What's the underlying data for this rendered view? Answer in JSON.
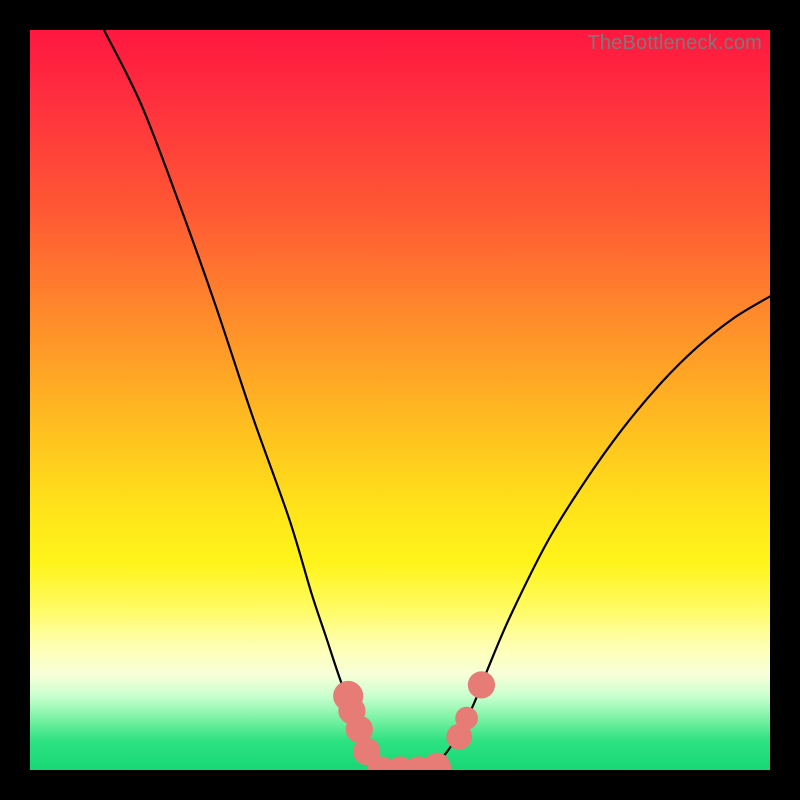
{
  "watermark": "TheBottleneck.com",
  "chart_data": {
    "type": "line",
    "title": "",
    "xlabel": "",
    "ylabel": "",
    "xlim": [
      0,
      100
    ],
    "ylim": [
      0,
      100
    ],
    "grid": false,
    "legend": false,
    "series": [
      {
        "name": "bottleneck-curve",
        "x": [
          10,
          15,
          20,
          25,
          30,
          35,
          38,
          40,
          42,
          44,
          45,
          46,
          48,
          50,
          52,
          54,
          56,
          58,
          60,
          62,
          65,
          70,
          75,
          80,
          85,
          90,
          95,
          100
        ],
        "y": [
          100,
          90,
          77,
          63,
          48,
          34,
          24,
          18,
          12,
          7,
          4,
          2,
          0,
          0,
          0,
          0,
          2,
          5,
          9,
          14,
          21,
          31,
          39,
          46,
          52,
          57,
          61,
          64
        ]
      }
    ],
    "markers": [
      {
        "name": "left-cluster-1",
        "x": 43.0,
        "y": 10.0,
        "r": 1.5
      },
      {
        "name": "left-cluster-2",
        "x": 43.5,
        "y": 8.0,
        "r": 1.3
      },
      {
        "name": "left-cluster-3",
        "x": 44.5,
        "y": 5.5,
        "r": 1.3
      },
      {
        "name": "left-cluster-4",
        "x": 45.5,
        "y": 2.5,
        "r": 1.3
      },
      {
        "name": "trough-1",
        "x": 47.5,
        "y": 0.0,
        "r": 1.3
      },
      {
        "name": "trough-2",
        "x": 50.0,
        "y": 0.0,
        "r": 1.3
      },
      {
        "name": "trough-3",
        "x": 52.5,
        "y": 0.0,
        "r": 1.3
      },
      {
        "name": "trough-4",
        "x": 55.0,
        "y": 0.5,
        "r": 1.3
      },
      {
        "name": "right-cluster-1",
        "x": 58.0,
        "y": 4.5,
        "r": 1.2
      },
      {
        "name": "right-cluster-2",
        "x": 59.0,
        "y": 7.0,
        "r": 1.0
      },
      {
        "name": "right-cluster-3",
        "x": 61.0,
        "y": 11.5,
        "r": 1.3
      }
    ],
    "marker_color": "#e77b76",
    "curve_color": "#000000"
  }
}
